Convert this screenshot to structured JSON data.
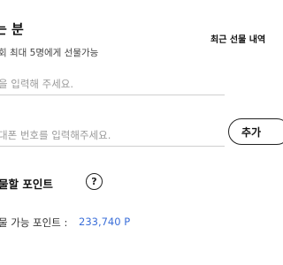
{
  "recipient": {
    "title": "는 분",
    "description": "회 최대 5명에게 선물가능",
    "name_placeholder": "을 입력해 주세요.",
    "phone_placeholder": "대폰 번호를 입력해주세요."
  },
  "history_link": "최근 선물 내역",
  "add_button": "추가",
  "points": {
    "title": "물할 포인트",
    "help_icon": "question-circle-icon",
    "help_glyph": "?",
    "available_label": "물 가능 포인트 :",
    "available_value": "233,740 P",
    "value_color": "#3b6fd9"
  }
}
